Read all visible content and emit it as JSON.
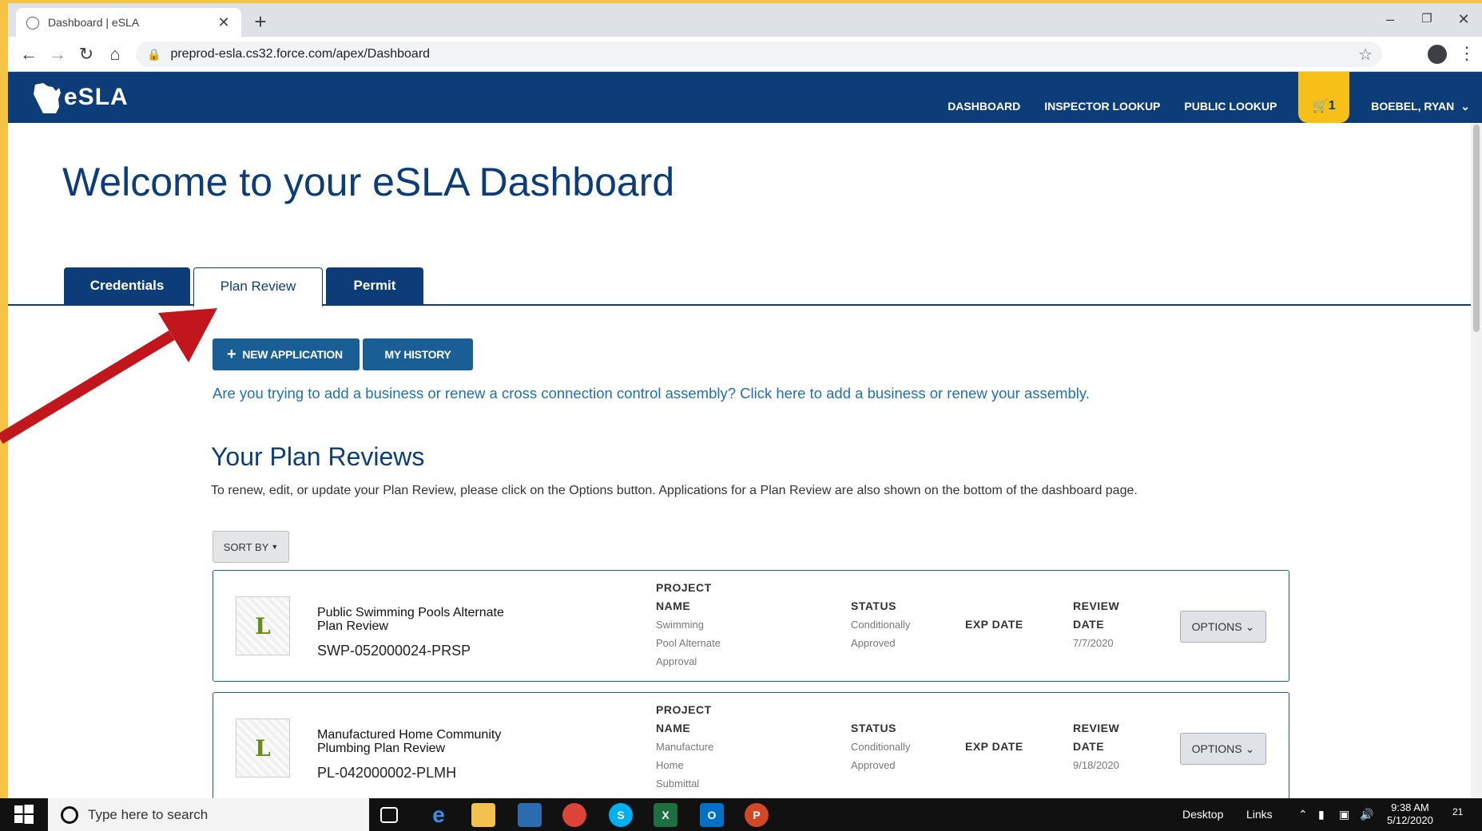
{
  "browser": {
    "tab_title": "Dashboard | eSLA",
    "url": "preprod-esla.cs32.force.com/apex/Dashboard"
  },
  "header": {
    "logo_text": "eSLA",
    "nav": [
      "DASHBOARD",
      "INSPECTOR LOOKUP",
      "PUBLIC LOOKUP"
    ],
    "cart_count": "1",
    "user_name": "BOEBEL, RYAN"
  },
  "page": {
    "title": "Welcome to your eSLA Dashboard",
    "tabs": [
      {
        "label": "Credentials",
        "active": false
      },
      {
        "label": "Plan Review",
        "active": true
      },
      {
        "label": "Permit",
        "active": false
      }
    ],
    "new_application_label": "NEW APPLICATION",
    "history_label": "MY HISTORY",
    "business_link": "Are you trying to add a business or renew a cross connection control assembly? Click here to add a business or renew your assembly.",
    "section_title": "Your Plan Reviews",
    "section_desc": "To renew, edit, or update your Plan Review, please click on the Options button. Applications for a Plan Review are also shown on the bottom of the dashboard page.",
    "sort_label": "SORT BY"
  },
  "reviews": [
    {
      "name": "Public Swimming Pools Alternate Plan Review",
      "code": "SWP-052000024-PRSP",
      "project_header_1": "PROJECT",
      "project_header_2": "NAME",
      "project_value": [
        "Swimming",
        "Pool Alternate",
        "Approval"
      ],
      "status_header": "STATUS",
      "status_value": [
        "Conditionally",
        "Approved"
      ],
      "exp_header": "EXP DATE",
      "review_header_1": "REVIEW",
      "review_header_2": "DATE",
      "review_date": "7/7/2020",
      "options_label": "OPTIONS"
    },
    {
      "name": "Manufactured Home Community Plumbing Plan Review",
      "code": "PL-042000002-PLMH",
      "project_header_1": "PROJECT",
      "project_header_2": "NAME",
      "project_value": [
        "Manufacture",
        "Home",
        "Submittal"
      ],
      "status_header": "STATUS",
      "status_value": [
        "Conditionally",
        "Approved"
      ],
      "exp_header": "EXP DATE",
      "review_header_1": "REVIEW",
      "review_header_2": "DATE",
      "review_date": "9/18/2020",
      "options_label": "OPTIONS"
    }
  ],
  "taskbar": {
    "search_placeholder": "Type here to search",
    "desktop_label": "Desktop",
    "links_label": "Links",
    "time": "9:38 AM",
    "date": "5/12/2020",
    "notification_count": "21"
  },
  "colors": {
    "brand_navy": "#0d3d78",
    "accent_yellow": "#f6c018",
    "link_blue": "#1f6fb2",
    "arrow_red": "#c0161c"
  },
  "icons": [
    "globe-icon",
    "close-icon",
    "plus-icon",
    "back-icon",
    "forward-icon",
    "reload-icon",
    "home-icon",
    "lock-icon",
    "star-icon",
    "profile-icon",
    "menu-icon",
    "wisconsin-logo-icon",
    "cart-icon",
    "chevron-down-icon",
    "windows-icon",
    "search-icon"
  ]
}
